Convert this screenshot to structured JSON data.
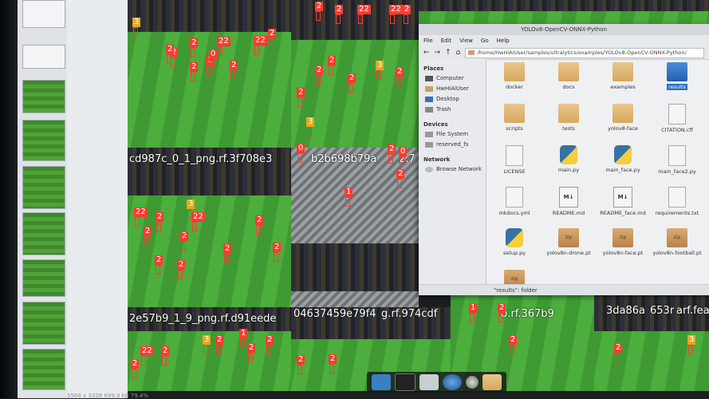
{
  "viewer": {
    "filename_labels": [
      "cd987c_0_1_png.rf.3f708e3",
      "b2b698b79a",
      "2.7",
      "2e57b9_1_9_png.rf.d91eede",
      "04637459e79f4",
      "g.rf.974cdf",
      "b.rf.367b9",
      "3da86a",
      "653r",
      "arf.fea"
    ],
    "detection_labels": [
      "3",
      "2",
      "2",
      "22",
      "22",
      "2",
      "1",
      "0",
      "2",
      "2",
      "2",
      "2",
      "2",
      "2",
      "3",
      "22",
      "22",
      "2",
      "2",
      "2",
      "2",
      "3",
      "2",
      "22",
      "2",
      "22",
      "2",
      "2",
      "2",
      "2",
      "3",
      "2",
      "2",
      "2",
      "1",
      "0",
      "2",
      "0",
      "2",
      "2",
      "22",
      "2",
      "3",
      "2",
      "2",
      "1",
      "2",
      "2",
      "2",
      "1",
      "2",
      "2",
      "2",
      "3"
    ],
    "bottom_status": "5568 x 3328    699.8 kB   79.4%"
  },
  "filemanager": {
    "title": "YOLOv8-OpenCV-ONNX-Python",
    "menu": [
      "File",
      "Edit",
      "View",
      "Go",
      "Help"
    ],
    "toolbar": [
      "←",
      "→",
      "↑",
      "⌂"
    ],
    "path": "/home/HwHiAiUser/samples/ultralytics/examples/YOLOv8-OpenCV-ONNX-Python/",
    "places_header": "Places",
    "places": [
      "Computer",
      "HwHiAiUser",
      "Desktop",
      "Trash"
    ],
    "devices_header": "Devices",
    "devices": [
      "File System",
      "reserved_fs"
    ],
    "network_header": "Network",
    "network": [
      "Browse Network"
    ],
    "files": [
      {
        "name": "docker",
        "type": "folder"
      },
      {
        "name": "docs",
        "type": "folder"
      },
      {
        "name": "examples",
        "type": "folder"
      },
      {
        "name": "results",
        "type": "folder-selected"
      },
      {
        "name": "scripts",
        "type": "folder"
      },
      {
        "name": "tests",
        "type": "folder"
      },
      {
        "name": "yolov8-face",
        "type": "folder"
      },
      {
        "name": "CITATION.cff",
        "type": "doc"
      },
      {
        "name": "LICENSE",
        "type": "doc"
      },
      {
        "name": "main.py",
        "type": "py"
      },
      {
        "name": "main_face.py",
        "type": "py"
      },
      {
        "name": "main_face2.py",
        "type": "doc"
      },
      {
        "name": "mkdocs.yml",
        "type": "doc"
      },
      {
        "name": "README.md",
        "type": "md"
      },
      {
        "name": "README_face.md",
        "type": "md"
      },
      {
        "name": "requirements.txt",
        "type": "doc"
      },
      {
        "name": "setup.py",
        "type": "py"
      },
      {
        "name": "yolov8n-drone.pt",
        "type": "zip"
      },
      {
        "name": "yolov8n-face.pt",
        "type": "zip"
      },
      {
        "name": "yolov8n-football.pt",
        "type": "zip"
      },
      {
        "name": "",
        "type": "zip"
      }
    ],
    "md_badge": "M↓",
    "zip_badge": "zip",
    "status": "\"results\": folder"
  },
  "taskbar": [
    "terminal-icon",
    "shell-icon",
    "files-icon",
    "browser-icon",
    "search-icon",
    "folder-icon"
  ]
}
